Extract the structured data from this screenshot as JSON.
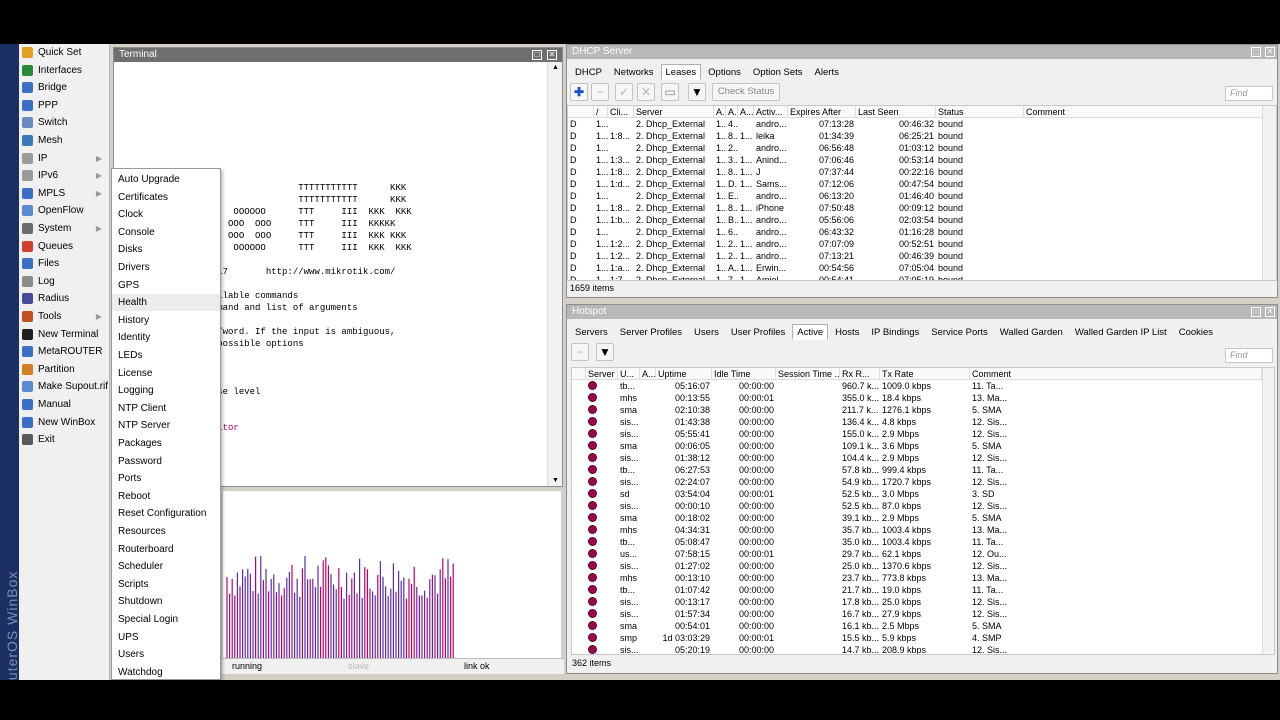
{
  "sidebar": {
    "brand": "RouterOS WinBox",
    "items": [
      {
        "label": "Quick Set",
        "icon": "quick-set-icon",
        "color": "#e0a020",
        "arrow": false
      },
      {
        "label": "Interfaces",
        "icon": "interfaces-icon",
        "color": "#2a8a3a",
        "arrow": false
      },
      {
        "label": "Bridge",
        "icon": "bridge-icon",
        "color": "#3a6fc8",
        "arrow": false
      },
      {
        "label": "PPP",
        "icon": "ppp-icon",
        "color": "#3a6fc8",
        "arrow": false
      },
      {
        "label": "Switch",
        "icon": "switch-icon",
        "color": "#6a8ac0",
        "arrow": false
      },
      {
        "label": "Mesh",
        "icon": "mesh-icon",
        "color": "#3a7ab8",
        "arrow": false
      },
      {
        "label": "IP",
        "icon": "ip-icon",
        "color": "#9a9a9a",
        "arrow": true
      },
      {
        "label": "IPv6",
        "icon": "ipv6-icon",
        "color": "#9a9a9a",
        "arrow": true
      },
      {
        "label": "MPLS",
        "icon": "mpls-icon",
        "color": "#3a6fc8",
        "arrow": true
      },
      {
        "label": "OpenFlow",
        "icon": "openflow-icon",
        "color": "#5a8ad0",
        "arrow": false
      },
      {
        "label": "System",
        "icon": "system-icon",
        "color": "#6a6a6a",
        "arrow": true
      },
      {
        "label": "Queues",
        "icon": "queues-icon",
        "color": "#d04030",
        "arrow": false
      },
      {
        "label": "Files",
        "icon": "files-icon",
        "color": "#3a6fc8",
        "arrow": false
      },
      {
        "label": "Log",
        "icon": "log-icon",
        "color": "#8a8a8a",
        "arrow": false
      },
      {
        "label": "Radius",
        "icon": "radius-icon",
        "color": "#4a4a9a",
        "arrow": false
      },
      {
        "label": "Tools",
        "icon": "tools-icon",
        "color": "#c05020",
        "arrow": true
      },
      {
        "label": "New Terminal",
        "icon": "terminal-icon",
        "color": "#202020",
        "arrow": false
      },
      {
        "label": "MetaROUTER",
        "icon": "metarouter-icon",
        "color": "#3a6fc8",
        "arrow": false
      },
      {
        "label": "Partition",
        "icon": "partition-icon",
        "color": "#d08020",
        "arrow": false
      },
      {
        "label": "Make Supout.rif",
        "icon": "supout-icon",
        "color": "#5a8ad0",
        "arrow": false
      },
      {
        "label": "Manual",
        "icon": "manual-icon",
        "color": "#3a6fc8",
        "arrow": false
      },
      {
        "label": "New WinBox",
        "icon": "winbox-icon",
        "color": "#3a6fc8",
        "arrow": false
      },
      {
        "label": "Exit",
        "icon": "exit-icon",
        "color": "#5a5a5a",
        "arrow": false
      }
    ]
  },
  "system_submenu": {
    "items": [
      "Auto Upgrade",
      "Certificates",
      "Clock",
      "Console",
      "Disks",
      "Drivers",
      "GPS",
      "Health",
      "History",
      "Identity",
      "LEDs",
      "License",
      "Logging",
      "NTP Client",
      "NTP Server",
      "Packages",
      "Password",
      "Ports",
      "Reboot",
      "Reset Configuration",
      "Resources",
      "Routerboard",
      "Scheduler",
      "Scripts",
      "Shutdown",
      "Special Login",
      "UPS",
      "Users",
      "Watchdog"
    ],
    "hovered": "Health"
  },
  "terminal": {
    "title": "Terminal",
    "lines": [
      "KKK                              TTTTTTTTTTT      KKK",
      "KKK                              TTTTTTTTTTT      KKK",
      "KKK  KKK  RRRRRR     OOOOOO      TTT     III  KKK  KKK",
      "KKKKK     RRR  RRR  OOO  OOO     TTT     III  KKKKK",
      "KKK KKK   RRRRRR    OOO  OOO     TTT     III  KKK KKK",
      "KKK  KKK  RRR  RRR   OOOOOO      TTT     III  KKK  KKK",
      "",
      "6.40.3 (c) 1999-2017       http://www.mikrotik.com/",
      "",
      "es the list of available commands",
      "es help on the command and list of arguments",
      "",
      "pletes the command/word. If the input is ambiguous,",
      "econd [Tab] gives possible options",
      "",
      "e up to base level",
      "e up one level",
      " command at the base level",
      "ystem res",
      "figuration",
      "ystem resource monitor",
      " 58%",
      " 56%,61%",
      " 1457996KiB",
      "-z pause]"
    ],
    "highlight_lines": [
      18,
      19,
      20
    ],
    "status": {
      "left": "running",
      "middle": "slave",
      "right": "link ok"
    }
  },
  "dhcp": {
    "title": "DHCP Server",
    "tabs": [
      "DHCP",
      "Networks",
      "Leases",
      "Options",
      "Option Sets",
      "Alerts"
    ],
    "active_tab": "Leases",
    "check_status": "Check Status",
    "find_placeholder": "Find",
    "columns": [
      "",
      "/",
      "Cli...",
      "Server",
      "A...",
      "A...",
      "A...",
      "Activ...",
      "Expires After",
      "Last Seen",
      "Status",
      "Comment"
    ],
    "rows": [
      [
        "D",
        "1...",
        "",
        "2. Dhcp_External",
        "1...",
        "4...",
        "",
        "andro...",
        "07:13:28",
        "00:46:32",
        "bound",
        ""
      ],
      [
        "D",
        "1...",
        "1:8...",
        "2. Dhcp_External",
        "1...",
        "8...",
        "1...",
        "leika",
        "01:34:39",
        "06:25:21",
        "bound",
        ""
      ],
      [
        "D",
        "1...",
        "",
        "2. Dhcp_External",
        "1...",
        "2...",
        "",
        "andro...",
        "06:56:48",
        "01:03:12",
        "bound",
        ""
      ],
      [
        "D",
        "1...",
        "1:3...",
        "2. Dhcp_External",
        "1...",
        "3...",
        "1...",
        "Anind...",
        "07:06:46",
        "00:53:14",
        "bound",
        ""
      ],
      [
        "D",
        "1...",
        "1:8...",
        "2. Dhcp_External",
        "1...",
        "8...",
        "1...",
        "J",
        "07:37:44",
        "00:22:16",
        "bound",
        ""
      ],
      [
        "D",
        "1...",
        "1:d...",
        "2. Dhcp_External",
        "1...",
        "D...",
        "1...",
        "Sams...",
        "07:12:06",
        "00:47:54",
        "bound",
        ""
      ],
      [
        "D",
        "1...",
        "",
        "2. Dhcp_External",
        "1...",
        "E...",
        "",
        "andro...",
        "06:13:20",
        "01:46:40",
        "bound",
        ""
      ],
      [
        "D",
        "1...",
        "1:8...",
        "2. Dhcp_External",
        "1...",
        "8...",
        "1...",
        "iPhone",
        "07:50:48",
        "00:09:12",
        "bound",
        ""
      ],
      [
        "D",
        "1...",
        "1:b...",
        "2. Dhcp_External",
        "1...",
        "B...",
        "1...",
        "andro...",
        "05:56:06",
        "02:03:54",
        "bound",
        ""
      ],
      [
        "D",
        "1...",
        "",
        "2. Dhcp_External",
        "1...",
        "6...",
        "",
        "andro...",
        "06:43:32",
        "01:16:28",
        "bound",
        ""
      ],
      [
        "D",
        "1...",
        "1:2...",
        "2. Dhcp_External",
        "1...",
        "2...",
        "1...",
        "andro...",
        "07:07:09",
        "00:52:51",
        "bound",
        ""
      ],
      [
        "D",
        "1...",
        "1:2...",
        "2. Dhcp_External",
        "1...",
        "2...",
        "1...",
        "andro...",
        "07:13:21",
        "00:46:39",
        "bound",
        ""
      ],
      [
        "D",
        "1...",
        "1:a...",
        "2. Dhcp_External",
        "1...",
        "A...",
        "1...",
        "Erwin...",
        "00:54:56",
        "07:05:04",
        "bound",
        ""
      ],
      [
        "D",
        "1...",
        "1:7...",
        "2. Dhcp_External",
        "1...",
        "7...",
        "1...",
        "Amiel...",
        "00:54:41",
        "07:05:19",
        "bound",
        ""
      ]
    ],
    "items_count": "1659 items"
  },
  "hotspot": {
    "title": "Hotspot",
    "tabs": [
      "Servers",
      "Server Profiles",
      "Users",
      "User Profiles",
      "Active",
      "Hosts",
      "IP Bindings",
      "Service Ports",
      "Walled Garden",
      "Walled Garden IP List",
      "Cookies"
    ],
    "active_tab": "Active",
    "find_placeholder": "Find",
    "columns": [
      "",
      "Server",
      "U...",
      "A...",
      "Uptime",
      "Idle Time",
      "Session Time ...",
      "Rx R...",
      "Tx Rate",
      "Comment"
    ],
    "rows": [
      [
        "",
        "tb...",
        "",
        "05:16:07",
        "00:00:00",
        "",
        "960.7 k...",
        "1009.0 kbps",
        "11. Ta..."
      ],
      [
        "",
        "mhs",
        "",
        "00:13:55",
        "00:00:01",
        "",
        "355.0 k...",
        "18.4 kbps",
        "13. Ma..."
      ],
      [
        "",
        "sma",
        "",
        "02:10:38",
        "00:00:00",
        "",
        "211.7 k...",
        "1276.1 kbps",
        "5. SMA"
      ],
      [
        "",
        "sis...",
        "",
        "01:43:38",
        "00:00:00",
        "",
        "136.4 k...",
        "4.8 kbps",
        "12. Sis..."
      ],
      [
        "",
        "sis...",
        "",
        "05:55:41",
        "00:00:00",
        "",
        "155.0 k...",
        "2.9 Mbps",
        "12. Sis..."
      ],
      [
        "",
        "sma",
        "",
        "00:06:05",
        "00:00:00",
        "",
        "109.1 k...",
        "3.6 Mbps",
        "5. SMA"
      ],
      [
        "",
        "sis...",
        "",
        "01:38:12",
        "00:00:00",
        "",
        "104.4 k...",
        "2.9 Mbps",
        "12. Sis..."
      ],
      [
        "",
        "tb...",
        "",
        "06:27:53",
        "00:00:00",
        "",
        "57.8 kb...",
        "999.4 kbps",
        "11. Ta..."
      ],
      [
        "",
        "sis...",
        "",
        "02:24:07",
        "00:00:00",
        "",
        "54.9 kb...",
        "1720.7 kbps",
        "12. Sis..."
      ],
      [
        "",
        "sd",
        "",
        "03:54:04",
        "00:00:01",
        "",
        "52.5 kb...",
        "3.0 Mbps",
        "3. SD"
      ],
      [
        "",
        "sis...",
        "",
        "00:00:10",
        "00:00:00",
        "",
        "52.5 kb...",
        "87.0 kbps",
        "12. Sis..."
      ],
      [
        "",
        "sma",
        "",
        "00:18:02",
        "00:00:00",
        "",
        "39.1 kb...",
        "2.9 Mbps",
        "5. SMA"
      ],
      [
        "",
        "mhs",
        "",
        "04:34:31",
        "00:00:00",
        "",
        "35.7 kb...",
        "1003.4 kbps",
        "13. Ma..."
      ],
      [
        "",
        "tb...",
        "",
        "05:08:47",
        "00:00:00",
        "",
        "35.0 kb...",
        "1003.4 kbps",
        "11. Ta..."
      ],
      [
        "",
        "us...",
        "",
        "07:58:15",
        "00:00:01",
        "",
        "29.7 kb...",
        "62.1 kbps",
        "12. Ou..."
      ],
      [
        "",
        "sis...",
        "",
        "01:27:02",
        "00:00:00",
        "",
        "25.0 kb...",
        "1370.6 kbps",
        "12. Sis..."
      ],
      [
        "",
        "mhs",
        "",
        "00:13:10",
        "00:00:00",
        "",
        "23.7 kb...",
        "773.8 kbps",
        "13. Ma..."
      ],
      [
        "",
        "tb...",
        "",
        "01:07:42",
        "00:00:00",
        "",
        "21.7 kb...",
        "19.0 kbps",
        "11. Ta..."
      ],
      [
        "",
        "sis...",
        "",
        "00:13:17",
        "00:00:00",
        "",
        "17.8 kb...",
        "25.0 kbps",
        "12. Sis..."
      ],
      [
        "",
        "sis...",
        "",
        "01:57:34",
        "00:00:00",
        "",
        "16.7 kb...",
        "27.9 kbps",
        "12. Sis..."
      ],
      [
        "",
        "sma",
        "",
        "00:54:01",
        "00:00:00",
        "",
        "16.1 kb...",
        "2.5 Mbps",
        "5. SMA"
      ],
      [
        "",
        "smp",
        "",
        "1d 03:03:29",
        "00:00:01",
        "",
        "15.5 kb...",
        "5.9 kbps",
        "4. SMP"
      ],
      [
        "",
        "sis...",
        "",
        "05:20:19",
        "00:00:00",
        "",
        "14.7 kb...",
        "208.9 kbps",
        "12. Sis..."
      ]
    ],
    "items_count": "362 items"
  }
}
